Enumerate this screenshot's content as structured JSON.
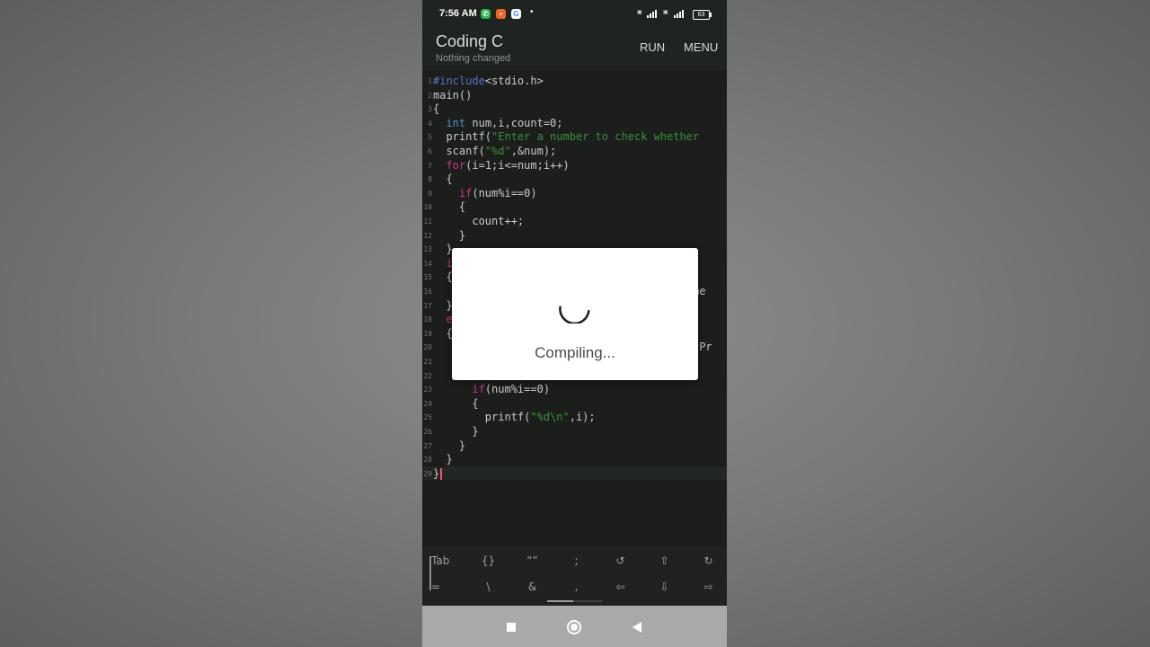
{
  "status_bar": {
    "time": "7:56 AM",
    "battery": "63"
  },
  "app_bar": {
    "title": "Coding C",
    "subtitle": "Nothing changed",
    "run_label": "RUN",
    "menu_label": "MENU"
  },
  "editor": {
    "lines": [
      {
        "num": "1",
        "text": "#include<stdio.h>"
      },
      {
        "num": "2",
        "text": "main()"
      },
      {
        "num": "3",
        "text": "{"
      },
      {
        "num": "4",
        "text": "  int num,i,count=0;"
      },
      {
        "num": "5",
        "text": "  printf(\"Enter a number to check whether"
      },
      {
        "num": "6",
        "text": "  scanf(\"%d\",&num);"
      },
      {
        "num": "7",
        "text": "  for(i=1;i<=num;i++)"
      },
      {
        "num": "8",
        "text": "  {"
      },
      {
        "num": "9",
        "text": "    if(num%i==0)"
      },
      {
        "num": "10",
        "text": "    {"
      },
      {
        "num": "11",
        "text": "      count++;"
      },
      {
        "num": "12",
        "text": "    }"
      },
      {
        "num": "13",
        "text": "  }"
      },
      {
        "num": "14",
        "text": "  i"
      },
      {
        "num": "15",
        "text": "  {"
      },
      {
        "num": "16",
        "text": "                                       ime"
      },
      {
        "num": "17",
        "text": "  }"
      },
      {
        "num": "18",
        "text": "  e"
      },
      {
        "num": "19",
        "text": "  {"
      },
      {
        "num": "20",
        "text": "                                       t Pr"
      },
      {
        "num": "21",
        "text": ""
      },
      {
        "num": "22",
        "text": ""
      },
      {
        "num": "23",
        "text": "      if(num%i==0)"
      },
      {
        "num": "24",
        "text": "      {"
      },
      {
        "num": "25",
        "text": "        printf(\"%d\\n\",i);"
      },
      {
        "num": "26",
        "text": "      }"
      },
      {
        "num": "27",
        "text": "    }"
      },
      {
        "num": "28",
        "text": "  }"
      },
      {
        "num": "29",
        "text": "}"
      }
    ]
  },
  "dialog": {
    "message": "Compiling..."
  },
  "extra_keys": {
    "row1": [
      "Tab",
      "{}",
      "“”",
      ";",
      "↺",
      "⇧",
      "↻"
    ],
    "row2": [
      "=",
      "\\",
      "&",
      ",",
      "⇦",
      "⇩",
      "⇨"
    ]
  },
  "icons": {
    "recents": "recents-icon",
    "home": "home-icon",
    "back": "back-icon",
    "spinner": "spinner-icon"
  }
}
